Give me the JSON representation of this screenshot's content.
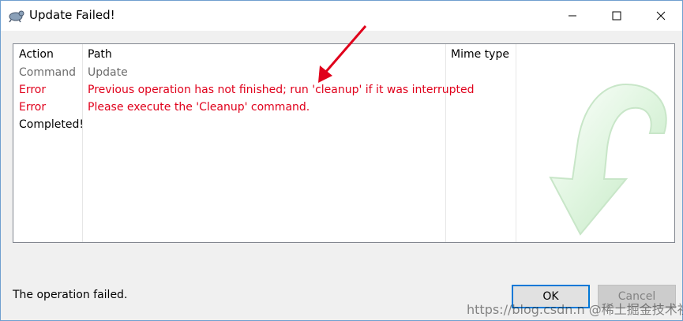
{
  "window": {
    "title": "Update Failed!"
  },
  "list": {
    "headers": {
      "action": "Action",
      "path": "Path",
      "mime": "Mime type"
    },
    "rows": [
      {
        "action": "Command",
        "path": "Update"
      },
      {
        "action": "Error",
        "path": "Previous operation has not finished; run 'cleanup' if it was interrupted"
      },
      {
        "action": "Error",
        "path": "Please execute the 'Cleanup' command."
      },
      {
        "action": "Completed!",
        "path": ""
      }
    ]
  },
  "status": {
    "text": "The operation failed."
  },
  "buttons": {
    "ok": "OK",
    "cancel": "Cancel"
  },
  "watermark": {
    "text": "https://blog.csdn.n @稀土掘金技术社区"
  },
  "colors": {
    "error": "#e0001b",
    "command": "#6d6d6d",
    "focus": "#0078d7"
  }
}
